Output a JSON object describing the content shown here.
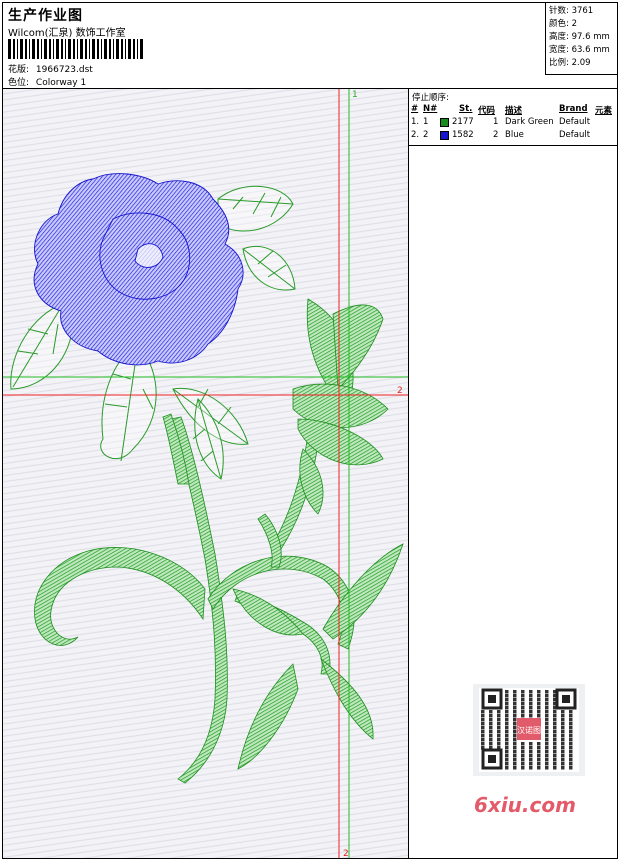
{
  "header": {
    "title": "生产作业图",
    "company": "Wilcom(汇泉) 数饰工作室",
    "design_label": "花版:",
    "design_value": "1966723.dst",
    "colorway_label": "色位:",
    "colorway_value": "Colorway 1"
  },
  "stats": [
    {
      "label": "针数:",
      "value": "3761"
    },
    {
      "label": "颜色:",
      "value": "2"
    },
    {
      "label": "高度:",
      "value": "97.6 mm"
    },
    {
      "label": "宽度:",
      "value": "63.6 mm"
    },
    {
      "label": "比例:",
      "value": "2.09"
    }
  ],
  "stop_sequence": {
    "title": "停止顺序:",
    "headers": [
      "#",
      "N#",
      "St.",
      "代码",
      "描述",
      "Brand",
      "元素"
    ],
    "rows": [
      {
        "num": "1.",
        "n": "1",
        "color": "#1a8a1a",
        "st": "2177",
        "code": "1",
        "desc": "Dark Green",
        "brand": "Default"
      },
      {
        "num": "2.",
        "n": "2",
        "color": "#1515cc",
        "st": "1582",
        "code": "2",
        "desc": "Blue",
        "brand": "Default"
      }
    ]
  },
  "markers": {
    "top": "1",
    "right": "2",
    "bottom": "2"
  },
  "colors": {
    "guide_red": "#ee2222",
    "guide_green": "#22bb22",
    "thread_green": "#22a022",
    "thread_blue": "#2222dd"
  },
  "watermark": {
    "site": "6xiu.com",
    "qr_stamp": "汉诺图"
  }
}
